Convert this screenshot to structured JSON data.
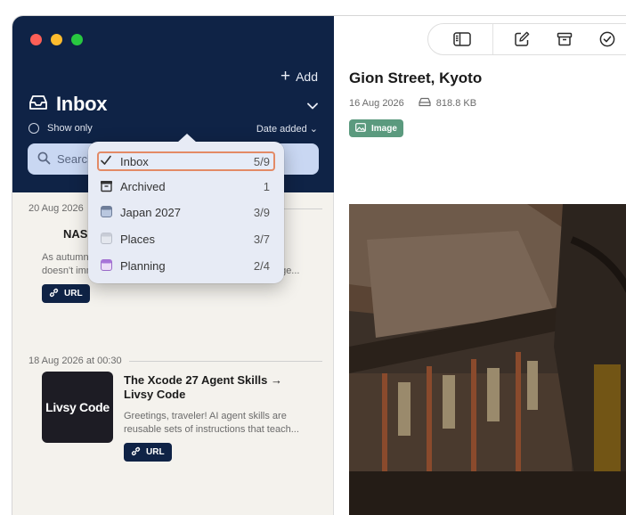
{
  "sidebar": {
    "add_label": "Add",
    "title": "Inbox",
    "show_only": "Show only",
    "sort": "Date added",
    "search_placeholder": "Search",
    "items": [
      {
        "date": "20 Aug 2026",
        "title": "NASA's Arctic...",
        "desc1": "As autumn turns to winter in the Arctic, the ground",
        "desc2": "doesn't immediately freeze solid. Instead, soils often linge...",
        "badge": "URL"
      },
      {
        "date": "18 Aug 2026 at 00:30",
        "thumb_text": "Livsy Code",
        "title1": "The Xcode 27 Agent Skills →",
        "title2": "Livsy Code",
        "desc1": "Greetings, traveler! AI agent skills are",
        "desc2": "reusable sets of instructions that teach...",
        "badge": "URL"
      }
    ]
  },
  "popover": {
    "items": [
      {
        "label": "Inbox",
        "count": "5/9",
        "selected": true,
        "icon": "checkmark-icon"
      },
      {
        "label": "Archived",
        "count": "1",
        "icon": "archive-box-icon"
      },
      {
        "label": "Japan 2027",
        "count": "3/9",
        "icon": "folder-icon"
      },
      {
        "label": "Places",
        "count": "3/7",
        "icon": "folder-icon"
      },
      {
        "label": "Planning",
        "count": "2/4",
        "icon": "folder-icon"
      }
    ]
  },
  "detail": {
    "title": "Gion Street, Kyoto",
    "date": "16 Aug 2026",
    "size": "818.8 KB",
    "badge": "Image"
  },
  "colors": {
    "sidebar_header": "#0f2346",
    "image_badge": "#5b9a7e",
    "selection_outline": "#e38a66"
  }
}
